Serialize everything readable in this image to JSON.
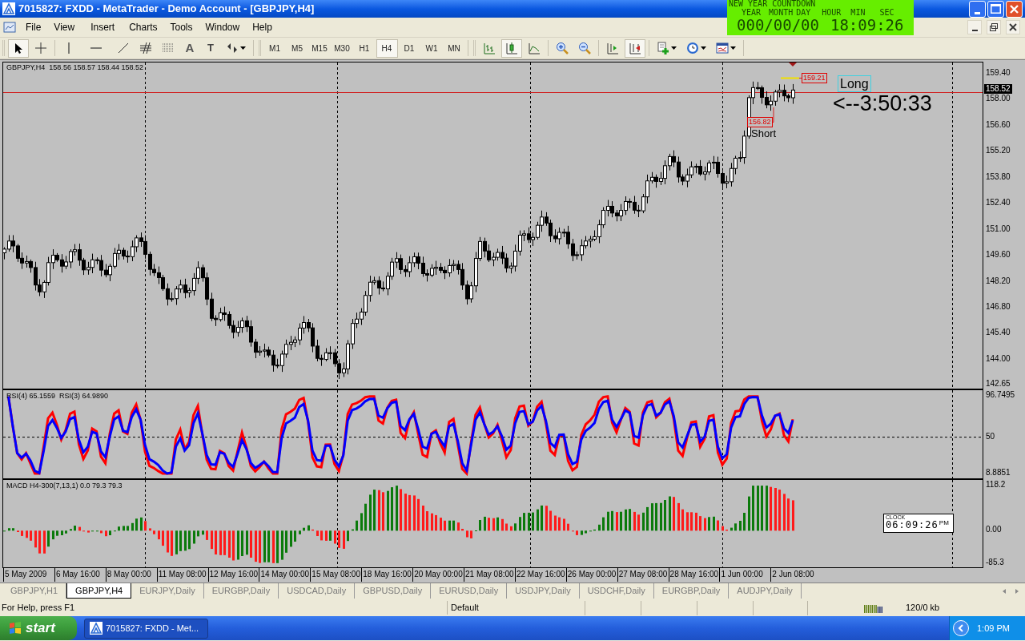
{
  "window": {
    "title": "7015827: FXDD - MetaTrader - Demo Account - [GBPJPY,H4]"
  },
  "countdown": {
    "title": "NEW YEAR COUNTDOWN",
    "headers": [
      "YEAR",
      "MONTH",
      "DAY",
      "HOUR",
      "MIN",
      "SEC"
    ],
    "date": "000/00/00",
    "time": "18:09:26"
  },
  "menu": [
    "File",
    "View",
    "Insert",
    "Charts",
    "Tools",
    "Window",
    "Help"
  ],
  "drawing_tools": [
    {
      "kind": "cursor",
      "selected": true
    },
    {
      "kind": "crosshair",
      "selected": false
    },
    {
      "kind": "vline",
      "selected": false
    },
    {
      "kind": "hline",
      "selected": false
    },
    {
      "kind": "trend",
      "selected": false
    },
    {
      "kind": "fibo",
      "selected": false
    },
    {
      "kind": "fibo-channel",
      "selected": false
    },
    {
      "kind": "text",
      "glyph": "A",
      "selected": false
    },
    {
      "kind": "label",
      "glyph": "T",
      "selected": false
    },
    {
      "kind": "arrows",
      "selected": false
    }
  ],
  "timeframes": [
    {
      "label": "M1",
      "selected": false
    },
    {
      "label": "M5",
      "selected": false
    },
    {
      "label": "M15",
      "selected": false
    },
    {
      "label": "M30",
      "selected": false
    },
    {
      "label": "H1",
      "selected": false
    },
    {
      "label": "H4",
      "selected": true
    },
    {
      "label": "D1",
      "selected": false
    },
    {
      "label": "W1",
      "selected": false
    },
    {
      "label": "MN",
      "selected": false
    }
  ],
  "chart_tools": [
    {
      "kind": "bars",
      "selected": false
    },
    {
      "kind": "candles",
      "selected": true
    },
    {
      "kind": "line",
      "selected": false
    },
    {
      "kind": "zoom-in",
      "selected": false
    },
    {
      "kind": "zoom-out",
      "selected": false
    },
    {
      "kind": "shift",
      "selected": false
    },
    {
      "kind": "autoscroll",
      "selected": true
    },
    {
      "kind": "new-chart",
      "selected": false
    },
    {
      "kind": "periodicity",
      "selected": false
    },
    {
      "kind": "templates",
      "selected": false
    }
  ],
  "main_pane": {
    "legend": "GBPJPY,H4  158.56 158.57 158.44 158.52",
    "price_labels": [
      "159.40",
      "158.00",
      "156.60",
      "155.20",
      "153.80",
      "152.40",
      "151.00",
      "149.60",
      "148.20",
      "146.80",
      "145.40",
      "144.00",
      "142.65"
    ],
    "current_price": "158.52",
    "high_label": "159.21",
    "low_label": "156.82",
    "short_label": "Short",
    "long_label": "Long",
    "timer": "<--3:50:33"
  },
  "rsi_pane": {
    "legend": "RSI(4) 65.1559  RSI(3) 64.9890",
    "labels": [
      "96.7495",
      "50",
      "8.8851"
    ]
  },
  "macd_pane": {
    "legend": "MACD H4-300(7,13,1) 0.0 79.3 79.3",
    "labels": [
      "118.2",
      "0.00",
      "-85.3"
    ],
    "clock": {
      "title": "CLOCK",
      "time": "06:09:26",
      "suffix": "PM"
    }
  },
  "time_axis": [
    "5 May 2009",
    "6 May 16:00",
    "8 May 00:00",
    "11 May 08:00",
    "12 May 16:00",
    "14 May 00:00",
    "15 May 08:00",
    "18 May 16:00",
    "20 May 00:00",
    "21 May 08:00",
    "22 May 16:00",
    "26 May 00:00",
    "27 May 08:00",
    "28 May 16:00",
    "1 Jun 00:00",
    "2 Jun 08:00"
  ],
  "tabs": [
    {
      "label": "GBPJPY,H1",
      "selected": false
    },
    {
      "label": "GBPJPY,H4",
      "selected": true
    },
    {
      "label": "EURJPY,Daily",
      "selected": false
    },
    {
      "label": "EURGBP,Daily",
      "selected": false
    },
    {
      "label": "USDCAD,Daily",
      "selected": false
    },
    {
      "label": "GBPUSD,Daily",
      "selected": false
    },
    {
      "label": "EURUSD,Daily",
      "selected": false
    },
    {
      "label": "USDJPY,Daily",
      "selected": false
    },
    {
      "label": "USDCHF,Daily",
      "selected": false
    },
    {
      "label": "EURGBP,Daily",
      "selected": false
    },
    {
      "label": "AUDJPY,Daily",
      "selected": false
    }
  ],
  "status_bar": {
    "help": "For Help, press F1",
    "profile": "Default",
    "traffic": "120/0 kb"
  },
  "taskbar": {
    "start": "start",
    "task": "7015827: FXDD - Met...",
    "clock": "1:09 PM"
  }
}
